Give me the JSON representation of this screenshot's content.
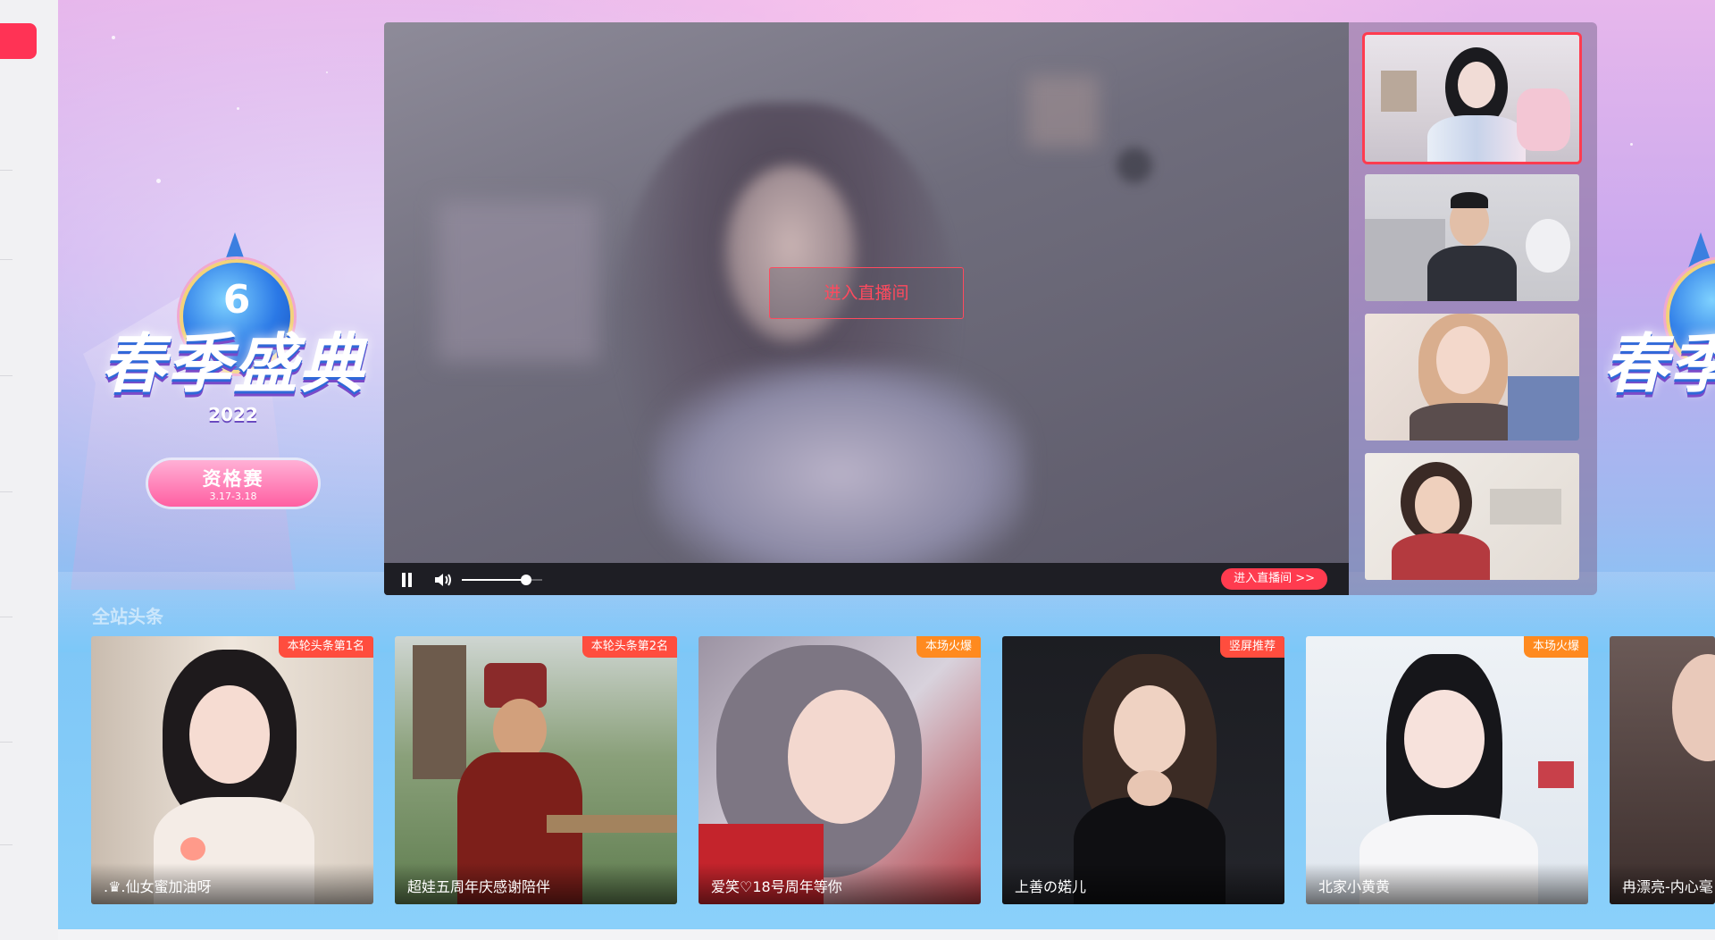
{
  "sidebar": {
    "active_color": "#ff3355"
  },
  "banner": {
    "logo_title": "春季盛典",
    "logo_number": "6",
    "logo_year": "2022",
    "badge_title": "资格赛",
    "badge_dates": "3.17-3.18",
    "right_logo_title": "春季"
  },
  "player": {
    "enter_room_center": "进入直播间",
    "enter_room_link": "进入直播间 >>",
    "volume_level": 0.8,
    "pause_icon": "pause-icon",
    "volume_icon": "volume-icon"
  },
  "section": {
    "title": "全站头条"
  },
  "cards": [
    {
      "name": ".♛.仙女蜜加油呀",
      "tag": "本轮头条第1名",
      "tag_color": "#ff4d3e"
    },
    {
      "name": "超娃五周年庆感谢陪伴",
      "tag": "本轮头条第2名",
      "tag_color": "#ff4d3e"
    },
    {
      "name": "爱笑♡18号周年等你",
      "tag": "本场火爆",
      "tag_color": "#ff8a1f"
    },
    {
      "name": "上善の婼儿",
      "tag": "竖屏推荐",
      "tag_color": "#ff4d3e"
    },
    {
      "name": "北家小黄黄",
      "tag": "本场火爆",
      "tag_color": "#ff8a1f"
    },
    {
      "name": "冉漂亮-内心毫"
    }
  ],
  "colors": {
    "accent": "#ff3b4f",
    "tag_red": "#ff4d3e",
    "tag_orange": "#ff8a1f"
  }
}
